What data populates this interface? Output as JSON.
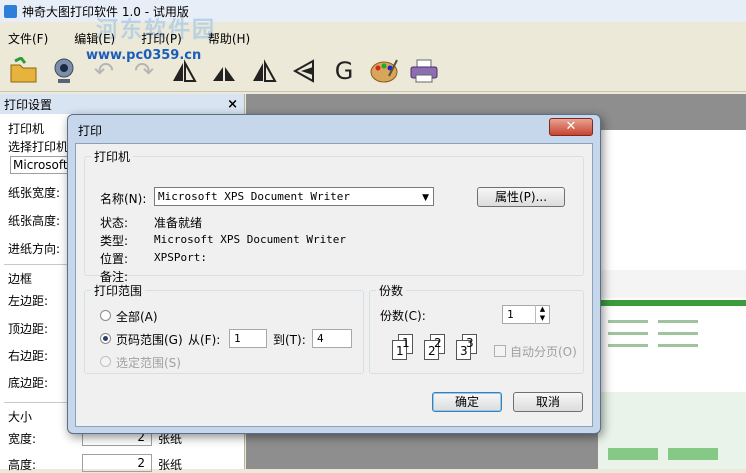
{
  "app": {
    "title": "神奇大图打印软件 1.0 - 试用版",
    "watermark": "河东软件园",
    "watermark_url": "www.pc0359.cn",
    "menu": [
      "文件(F)",
      "编辑(E)",
      "打印(P)",
      "帮助(H)"
    ],
    "toolbar_letter": "G"
  },
  "panel": {
    "title": "打印设置",
    "close": "×",
    "printer_label": "打印机",
    "select_printer_label": "选择打印机",
    "printer_value": "Microsoft X",
    "paper_width_label": "纸张宽度:",
    "paper_height_label": "纸张高度:",
    "feed_direction_label": "进纸方向:",
    "margins_label": "边框",
    "left_margin_label": "左边距:",
    "top_margin_label": "顶边距:",
    "right_margin_label": "右边距:",
    "bottom_margin_label": "底边距:",
    "size_label": "大小",
    "width_label": "宽度:",
    "width_value": "2",
    "width_unit": "张纸",
    "height_label": "高度:",
    "height_value": "2",
    "height_unit": "张纸"
  },
  "dialog": {
    "title": "打印",
    "close": "✕",
    "printer_group": "打印机",
    "name_label": "名称(N):",
    "name_value": "Microsoft XPS Document Writer",
    "properties_button": "属性(P)...",
    "status_label": "状态:",
    "status_value": "准备就绪",
    "type_label": "类型:",
    "type_value": "Microsoft XPS Document Writer",
    "location_label": "位置:",
    "location_value": "XPSPort:",
    "comment_label": "备注:",
    "range_group": "打印范围",
    "all_label": "全部(A)",
    "pages_label": "页码范围(G)",
    "from_label": "从(F):",
    "from_value": "1",
    "to_label": "到(T):",
    "to_value": "4",
    "selection_label": "选定范围(S)",
    "copies_group": "份数",
    "copies_label": "份数(C):",
    "copies_value": "1",
    "collate_label": "自动分页(O)",
    "collate_numbers": [
      "1",
      "1",
      "2",
      "2",
      "3",
      "3"
    ],
    "ok_button": "确定",
    "cancel_button": "取消"
  }
}
